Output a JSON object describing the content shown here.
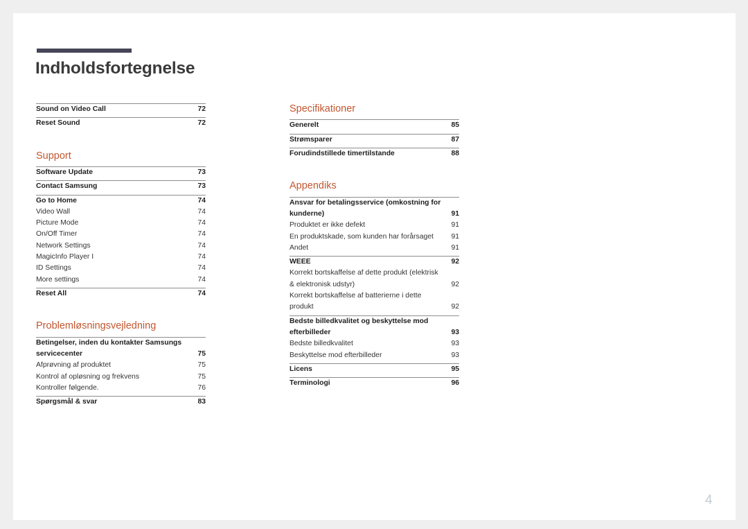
{
  "document": {
    "title": "Indholdsfortegnelse",
    "page_number": "4",
    "accent_color": "#c2562f",
    "title_bar_color": "#454458",
    "rule_color": "#8d8d8d",
    "page_number_color": "#c3ccd3"
  },
  "left_column": [
    {
      "section_title": null,
      "groups": [
        {
          "rows": [
            {
              "label": "Sound on Video Call",
              "page": "72",
              "style": "bold"
            }
          ]
        },
        {
          "rows": [
            {
              "label": "Reset Sound",
              "page": "72",
              "style": "bold"
            }
          ]
        }
      ]
    },
    {
      "section_title": "Support",
      "groups": [
        {
          "rows": [
            {
              "label": "Software Update",
              "page": "73",
              "style": "bold"
            }
          ]
        },
        {
          "rows": [
            {
              "label": "Contact Samsung",
              "page": "73",
              "style": "bold"
            }
          ]
        },
        {
          "rows": [
            {
              "label": "Go to Home",
              "page": "74",
              "style": "bold"
            },
            {
              "label": "Video Wall",
              "page": "74",
              "style": "sub"
            },
            {
              "label": "Picture Mode",
              "page": "74",
              "style": "sub"
            },
            {
              "label": "On/Off Timer",
              "page": "74",
              "style": "sub"
            },
            {
              "label": "Network Settings",
              "page": "74",
              "style": "sub"
            },
            {
              "label": "MagicInfo Player I",
              "page": "74",
              "style": "sub"
            },
            {
              "label": "ID Settings",
              "page": "74",
              "style": "sub"
            },
            {
              "label": "More settings",
              "page": "74",
              "style": "sub"
            }
          ]
        },
        {
          "rows": [
            {
              "label": "Reset All",
              "page": "74",
              "style": "bold"
            }
          ]
        }
      ]
    },
    {
      "section_title": "Problemløsningsvejledning",
      "groups": [
        {
          "rows": [
            {
              "label": "Betingelser, inden du kontakter Samsungs servicecenter",
              "page": "75",
              "style": "bold",
              "multiline": true
            },
            {
              "label": "Afprøvning af produktet",
              "page": "75",
              "style": "sub"
            },
            {
              "label": "Kontrol af opløsning og frekvens",
              "page": "75",
              "style": "sub"
            },
            {
              "label": "Kontroller følgende.",
              "page": "76",
              "style": "sub"
            }
          ]
        },
        {
          "rows": [
            {
              "label": "Spørgsmål & svar",
              "page": "83",
              "style": "bold"
            }
          ]
        }
      ]
    }
  ],
  "right_column": [
    {
      "section_title": "Specifikationer",
      "groups": [
        {
          "rows": [
            {
              "label": "Generelt",
              "page": "85",
              "style": "bold"
            }
          ]
        },
        {
          "rows": [
            {
              "label": "Strømsparer",
              "page": "87",
              "style": "bold"
            }
          ]
        },
        {
          "rows": [
            {
              "label": "Forudindstillede timertilstande",
              "page": "88",
              "style": "bold"
            }
          ]
        }
      ]
    },
    {
      "section_title": "Appendiks",
      "groups": [
        {
          "rows": [
            {
              "label": "Ansvar for betalingsservice (omkostning for kunderne)",
              "page": "91",
              "style": "bold",
              "multiline": true
            },
            {
              "label": "Produktet er ikke defekt",
              "page": "91",
              "style": "sub"
            },
            {
              "label": "En produktskade, som kunden har forårsaget",
              "page": "91",
              "style": "sub"
            },
            {
              "label": "Andet",
              "page": "91",
              "style": "sub"
            }
          ]
        },
        {
          "rows": [
            {
              "label": "WEEE",
              "page": "92",
              "style": "bold"
            },
            {
              "label": "Korrekt bortskaffelse af dette produkt (elektrisk & elektronisk udstyr)",
              "page": "92",
              "style": "sub",
              "multiline": true
            },
            {
              "label": "Korrekt bortskaffelse af batterierne i dette produkt",
              "page": "92",
              "style": "sub",
              "multiline": true
            }
          ]
        },
        {
          "rows": [
            {
              "label": "Bedste billedkvalitet og beskyttelse mod efterbilleder",
              "page": "93",
              "style": "bold",
              "multiline": true
            },
            {
              "label": "Bedste billedkvalitet",
              "page": "93",
              "style": "sub"
            },
            {
              "label": "Beskyttelse mod efterbilleder",
              "page": "93",
              "style": "sub"
            }
          ]
        },
        {
          "rows": [
            {
              "label": "Licens",
              "page": "95",
              "style": "bold"
            }
          ]
        },
        {
          "rows": [
            {
              "label": "Terminologi",
              "page": "96",
              "style": "bold"
            }
          ]
        }
      ]
    }
  ]
}
